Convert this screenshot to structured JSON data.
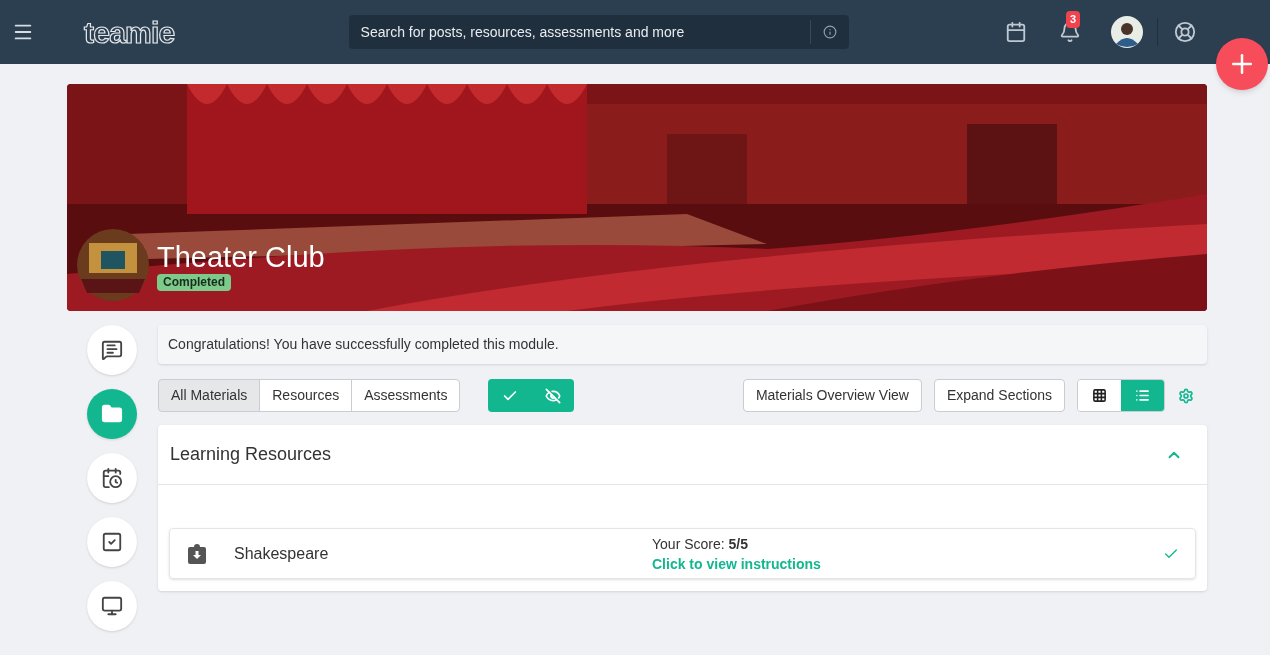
{
  "header": {
    "logo_text": "teamie",
    "search": {
      "placeholder": "Search for posts, resources, assessments and more"
    },
    "notifications": {
      "count": "3"
    }
  },
  "banner": {
    "kind": "picture",
    "title": "Theater Club",
    "status": "Completed"
  },
  "rail": [
    {
      "kind": "posts",
      "selected": false
    },
    {
      "kind": "materials",
      "selected": true
    },
    {
      "kind": "planner",
      "selected": false
    },
    {
      "kind": "tasks",
      "selected": false
    },
    {
      "kind": "screen",
      "selected": false
    }
  ],
  "message": "Congratulations! You have successfully completed this module.",
  "filters": [
    {
      "label": "All Materials",
      "selected": true
    },
    {
      "label": "Resources",
      "selected": false
    },
    {
      "label": "Assessments",
      "selected": false
    }
  ],
  "toggles": [
    {
      "kind": "completed",
      "on": true
    },
    {
      "kind": "hidden",
      "on": true
    }
  ],
  "actions": [
    "Materials Overview View",
    "Expand Sections"
  ],
  "views": [
    {
      "kind": "grid",
      "selected": false
    },
    {
      "kind": "list",
      "selected": true
    }
  ],
  "section": {
    "title": "Learning Resources",
    "expanded": true,
    "items": [
      {
        "title": "Shakespeare",
        "score": "Your Score: **5/5**",
        "link": "Click to view instructions",
        "done": true
      }
    ]
  }
}
